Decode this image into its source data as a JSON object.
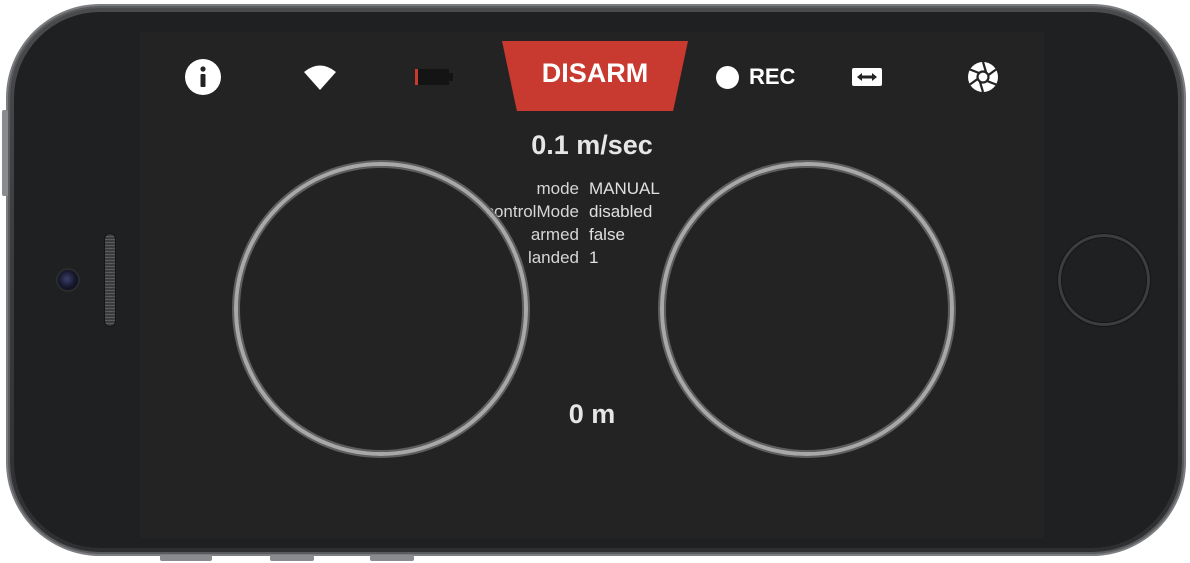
{
  "toolbar": {
    "info_icon": "info-icon",
    "wifi_icon": "wifi-icon",
    "battery_icon": "battery-icon",
    "disarm_label": "DISARM",
    "rec_label": "REC",
    "flip_camera_icon": "flip-camera-icon",
    "shutter_icon": "shutter-icon"
  },
  "telemetry": {
    "speed": "0.1 m/sec",
    "altitude": "0 m",
    "rows": [
      {
        "key": "mode",
        "value": "MANUAL"
      },
      {
        "key": "controlMode",
        "value": "disabled"
      },
      {
        "key": "armed",
        "value": "false"
      },
      {
        "key": "landed",
        "value": "1"
      }
    ]
  },
  "colors": {
    "disarm_bg": "#c8392f",
    "screen_bg": "#232323",
    "battery_low": "#c8392f"
  }
}
